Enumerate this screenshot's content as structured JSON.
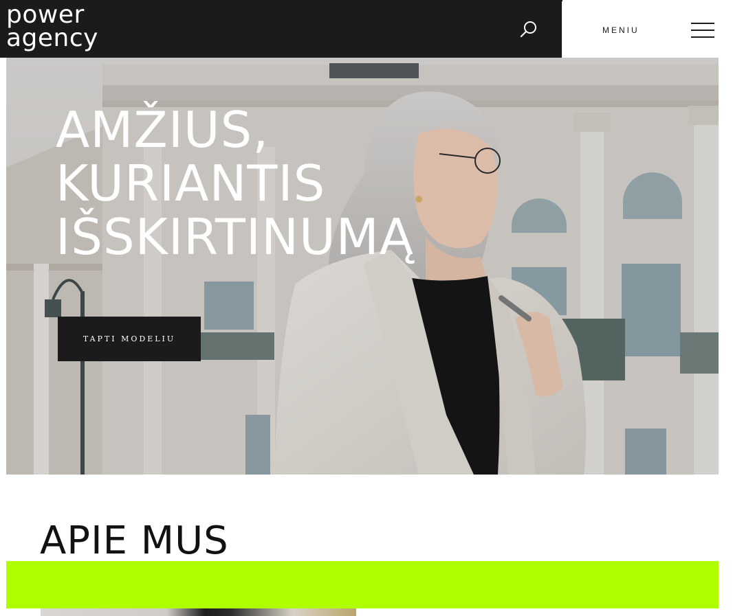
{
  "header": {
    "logo_line1": "power",
    "logo_line2": "agency",
    "search_icon": "search-icon",
    "menu_label": "MENIU",
    "menu_icon": "hamburger-icon"
  },
  "hero": {
    "title_lines": [
      "AMŽIUS,",
      "KURIANTIS",
      "IŠSKIRTINUMĄ"
    ],
    "cta_label": "TAPTI MODELIU"
  },
  "about": {
    "title": "APIE MUS"
  },
  "colors": {
    "dark": "#1b1b1b",
    "accent_lime": "#b0ff00",
    "white": "#ffffff"
  }
}
